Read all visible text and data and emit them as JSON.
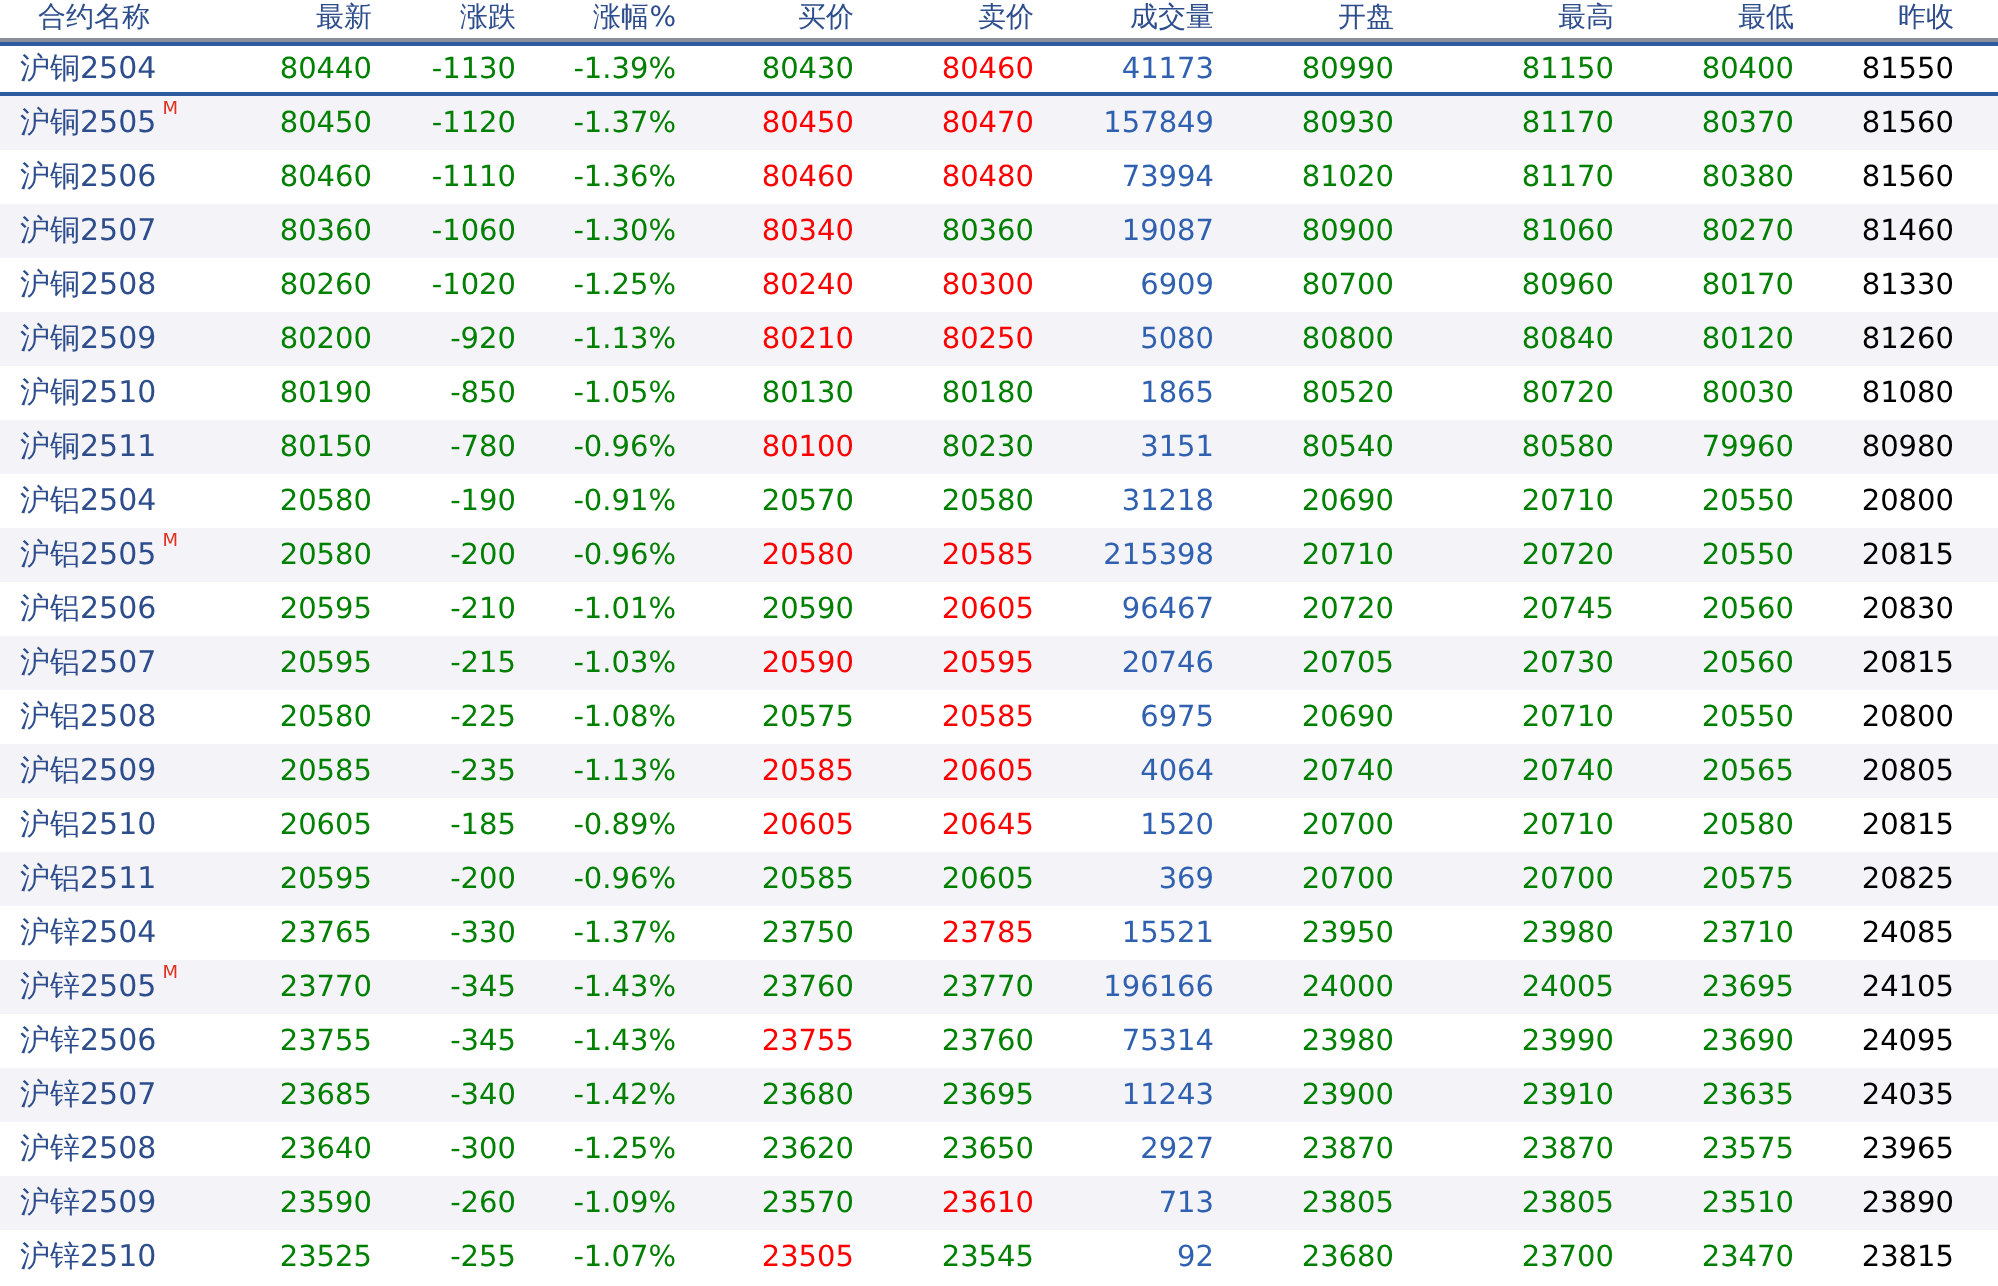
{
  "table": {
    "columns": [
      "合约名称",
      "最新",
      "涨跌",
      "涨幅%",
      "买价",
      "卖价",
      "成交量",
      "开盘",
      "最高",
      "最低",
      "昨收"
    ],
    "rows": [
      {
        "name": "沪铜2504",
        "selected": true,
        "last": "80440",
        "change": "-1130",
        "pct": "-1.39%",
        "bid": {
          "value": "80430",
          "color": "#008000"
        },
        "ask": {
          "value": "80460",
          "color": "#ff0000"
        },
        "volume": "41173",
        "open": "80990",
        "high": "81150",
        "low": "80400",
        "prev_close": "81550"
      },
      {
        "name": "沪铜2505",
        "marker": "M",
        "selected": false,
        "last": "80450",
        "change": "-1120",
        "pct": "-1.37%",
        "bid": {
          "value": "80450",
          "color": "#ff0000"
        },
        "ask": {
          "value": "80470",
          "color": "#ff0000"
        },
        "volume": "157849",
        "open": "80930",
        "high": "81170",
        "low": "80370",
        "prev_close": "81560"
      },
      {
        "name": "沪铜2506",
        "selected": false,
        "last": "80460",
        "change": "-1110",
        "pct": "-1.36%",
        "bid": {
          "value": "80460",
          "color": "#ff0000"
        },
        "ask": {
          "value": "80480",
          "color": "#ff0000"
        },
        "volume": "73994",
        "open": "81020",
        "high": "81170",
        "low": "80380",
        "prev_close": "81560"
      },
      {
        "name": "沪铜2507",
        "selected": false,
        "last": "80360",
        "change": "-1060",
        "pct": "-1.30%",
        "bid": {
          "value": "80340",
          "color": "#ff0000"
        },
        "ask": {
          "value": "80360",
          "color": "#008000"
        },
        "volume": "19087",
        "open": "80900",
        "high": "81060",
        "low": "80270",
        "prev_close": "81460"
      },
      {
        "name": "沪铜2508",
        "selected": false,
        "last": "80260",
        "change": "-1020",
        "pct": "-1.25%",
        "bid": {
          "value": "80240",
          "color": "#ff0000"
        },
        "ask": {
          "value": "80300",
          "color": "#ff0000"
        },
        "volume": "6909",
        "open": "80700",
        "high": "80960",
        "low": "80170",
        "prev_close": "81330"
      },
      {
        "name": "沪铜2509",
        "selected": false,
        "last": "80200",
        "change": "-920",
        "pct": "-1.13%",
        "bid": {
          "value": "80210",
          "color": "#ff0000"
        },
        "ask": {
          "value": "80250",
          "color": "#ff0000"
        },
        "volume": "5080",
        "open": "80800",
        "high": "80840",
        "low": "80120",
        "prev_close": "81260"
      },
      {
        "name": "沪铜2510",
        "selected": false,
        "last": "80190",
        "change": "-850",
        "pct": "-1.05%",
        "bid": {
          "value": "80130",
          "color": "#008000"
        },
        "ask": {
          "value": "80180",
          "color": "#008000"
        },
        "volume": "1865",
        "open": "80520",
        "high": "80720",
        "low": "80030",
        "prev_close": "81080"
      },
      {
        "name": "沪铜2511",
        "selected": false,
        "last": "80150",
        "change": "-780",
        "pct": "-0.96%",
        "bid": {
          "value": "80100",
          "color": "#ff0000"
        },
        "ask": {
          "value": "80230",
          "color": "#008000"
        },
        "volume": "3151",
        "open": "80540",
        "high": "80580",
        "low": "79960",
        "prev_close": "80980"
      },
      {
        "name": "沪铝2504",
        "selected": false,
        "last": "20580",
        "change": "-190",
        "pct": "-0.91%",
        "bid": {
          "value": "20570",
          "color": "#008000"
        },
        "ask": {
          "value": "20580",
          "color": "#008000"
        },
        "volume": "31218",
        "open": "20690",
        "high": "20710",
        "low": "20550",
        "prev_close": "20800"
      },
      {
        "name": "沪铝2505",
        "marker": "M",
        "selected": false,
        "last": "20580",
        "change": "-200",
        "pct": "-0.96%",
        "bid": {
          "value": "20580",
          "color": "#ff0000"
        },
        "ask": {
          "value": "20585",
          "color": "#ff0000"
        },
        "volume": "215398",
        "open": "20710",
        "high": "20720",
        "low": "20550",
        "prev_close": "20815"
      },
      {
        "name": "沪铝2506",
        "selected": false,
        "last": "20595",
        "change": "-210",
        "pct": "-1.01%",
        "bid": {
          "value": "20590",
          "color": "#008000"
        },
        "ask": {
          "value": "20605",
          "color": "#ff0000"
        },
        "volume": "96467",
        "open": "20720",
        "high": "20745",
        "low": "20560",
        "prev_close": "20830"
      },
      {
        "name": "沪铝2507",
        "selected": false,
        "last": "20595",
        "change": "-215",
        "pct": "-1.03%",
        "bid": {
          "value": "20590",
          "color": "#ff0000"
        },
        "ask": {
          "value": "20595",
          "color": "#ff0000"
        },
        "volume": "20746",
        "open": "20705",
        "high": "20730",
        "low": "20560",
        "prev_close": "20815"
      },
      {
        "name": "沪铝2508",
        "selected": false,
        "last": "20580",
        "change": "-225",
        "pct": "-1.08%",
        "bid": {
          "value": "20575",
          "color": "#008000"
        },
        "ask": {
          "value": "20585",
          "color": "#ff0000"
        },
        "volume": "6975",
        "open": "20690",
        "high": "20710",
        "low": "20550",
        "prev_close": "20800"
      },
      {
        "name": "沪铝2509",
        "selected": false,
        "last": "20585",
        "change": "-235",
        "pct": "-1.13%",
        "bid": {
          "value": "20585",
          "color": "#ff0000"
        },
        "ask": {
          "value": "20605",
          "color": "#ff0000"
        },
        "volume": "4064",
        "open": "20740",
        "high": "20740",
        "low": "20565",
        "prev_close": "20805"
      },
      {
        "name": "沪铝2510",
        "selected": false,
        "last": "20605",
        "change": "-185",
        "pct": "-0.89%",
        "bid": {
          "value": "20605",
          "color": "#ff0000"
        },
        "ask": {
          "value": "20645",
          "color": "#ff0000"
        },
        "volume": "1520",
        "open": "20700",
        "high": "20710",
        "low": "20580",
        "prev_close": "20815"
      },
      {
        "name": "沪铝2511",
        "selected": false,
        "last": "20595",
        "change": "-200",
        "pct": "-0.96%",
        "bid": {
          "value": "20585",
          "color": "#008000"
        },
        "ask": {
          "value": "20605",
          "color": "#008000"
        },
        "volume": "369",
        "open": "20700",
        "high": "20700",
        "low": "20575",
        "prev_close": "20825"
      },
      {
        "name": "沪锌2504",
        "selected": false,
        "last": "23765",
        "change": "-330",
        "pct": "-1.37%",
        "bid": {
          "value": "23750",
          "color": "#008000"
        },
        "ask": {
          "value": "23785",
          "color": "#ff0000"
        },
        "volume": "15521",
        "open": "23950",
        "high": "23980",
        "low": "23710",
        "prev_close": "24085"
      },
      {
        "name": "沪锌2505",
        "marker": "M",
        "selected": false,
        "last": "23770",
        "change": "-345",
        "pct": "-1.43%",
        "bid": {
          "value": "23760",
          "color": "#008000"
        },
        "ask": {
          "value": "23770",
          "color": "#008000"
        },
        "volume": "196166",
        "open": "24000",
        "high": "24005",
        "low": "23695",
        "prev_close": "24105"
      },
      {
        "name": "沪锌2506",
        "selected": false,
        "last": "23755",
        "change": "-345",
        "pct": "-1.43%",
        "bid": {
          "value": "23755",
          "color": "#ff0000"
        },
        "ask": {
          "value": "23760",
          "color": "#008000"
        },
        "volume": "75314",
        "open": "23980",
        "high": "23990",
        "low": "23690",
        "prev_close": "24095"
      },
      {
        "name": "沪锌2507",
        "selected": false,
        "last": "23685",
        "change": "-340",
        "pct": "-1.42%",
        "bid": {
          "value": "23680",
          "color": "#008000"
        },
        "ask": {
          "value": "23695",
          "color": "#008000"
        },
        "volume": "11243",
        "open": "23900",
        "high": "23910",
        "low": "23635",
        "prev_close": "24035"
      },
      {
        "name": "沪锌2508",
        "selected": false,
        "last": "23640",
        "change": "-300",
        "pct": "-1.25%",
        "bid": {
          "value": "23620",
          "color": "#008000"
        },
        "ask": {
          "value": "23650",
          "color": "#008000"
        },
        "volume": "2927",
        "open": "23870",
        "high": "23870",
        "low": "23575",
        "prev_close": "23965"
      },
      {
        "name": "沪锌2509",
        "selected": false,
        "last": "23590",
        "change": "-260",
        "pct": "-1.09%",
        "bid": {
          "value": "23570",
          "color": "#008000"
        },
        "ask": {
          "value": "23610",
          "color": "#ff0000"
        },
        "volume": "713",
        "open": "23805",
        "high": "23805",
        "low": "23510",
        "prev_close": "23890"
      },
      {
        "name": "沪锌2510",
        "selected": false,
        "last": "23525",
        "change": "-255",
        "pct": "-1.07%",
        "bid": {
          "value": "23505",
          "color": "#ff0000"
        },
        "ask": {
          "value": "23545",
          "color": "#008000"
        },
        "volume": "92",
        "open": "23680",
        "high": "23700",
        "low": "23470",
        "prev_close": "23815"
      }
    ]
  }
}
